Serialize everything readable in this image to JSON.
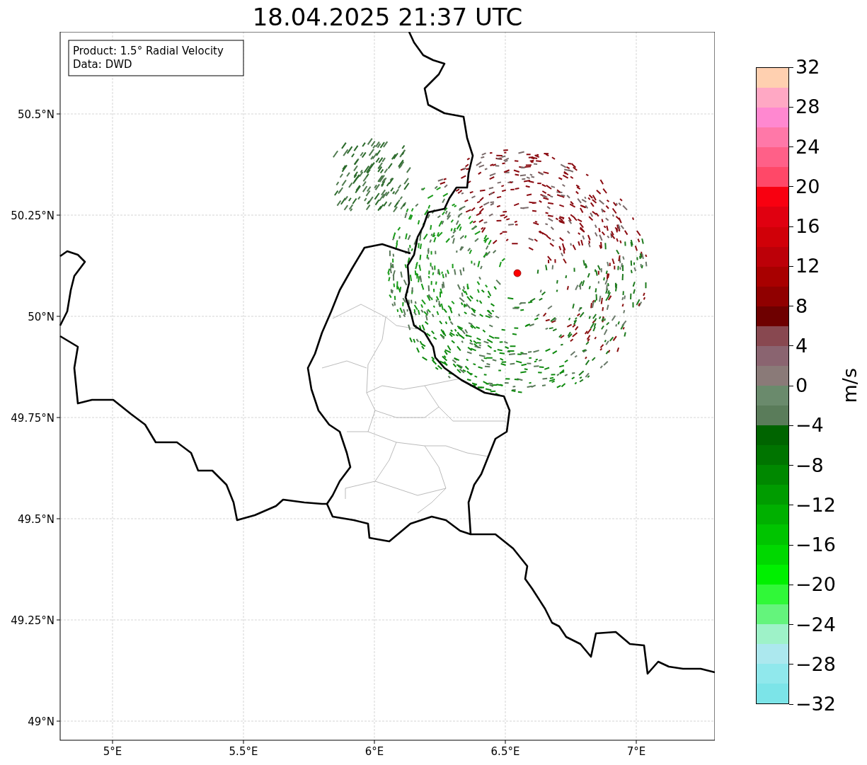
{
  "title": "18.04.2025 21:37 UTC",
  "info_box": {
    "lines": [
      "Product: 1.5° Radial Velocity",
      "Data: DWD"
    ]
  },
  "map": {
    "x_ticks": [
      "5°E",
      "5.5°E",
      "6°E",
      "6.5°E",
      "7°E"
    ],
    "y_ticks": [
      "50.5°N",
      "50.25°N",
      "50°N",
      "49.75°N",
      "49.5°N",
      "49.25°N",
      "49°N"
    ]
  },
  "colorbar": {
    "label": "m/s",
    "ticks": [
      "32",
      "28",
      "24",
      "20",
      "16",
      "12",
      "8",
      "4",
      "0",
      "−4",
      "−8",
      "−12",
      "−16",
      "−20",
      "−24",
      "−28",
      "−32"
    ],
    "bins": [
      {
        "color": "#ffd0b0"
      },
      {
        "color": "#ffa8c4"
      },
      {
        "color": "#ff88d0"
      },
      {
        "color": "#ff78a8"
      },
      {
        "color": "#ff6088"
      },
      {
        "color": "#ff4868"
      },
      {
        "color": "#f80010"
      },
      {
        "color": "#e00010"
      },
      {
        "color": "#d00008"
      },
      {
        "color": "#bc0008"
      },
      {
        "color": "#a80000"
      },
      {
        "color": "#900000"
      },
      {
        "color": "#6e0000"
      },
      {
        "color": "#884850"
      },
      {
        "color": "#8a6470"
      },
      {
        "color": "#8a7a78"
      },
      {
        "color": "#6a8a6c"
      },
      {
        "color": "#5a7c5a"
      },
      {
        "color": "#006400"
      },
      {
        "color": "#007400"
      },
      {
        "color": "#008800"
      },
      {
        "color": "#009c00"
      },
      {
        "color": "#00b000"
      },
      {
        "color": "#00c400"
      },
      {
        "color": "#00d800"
      },
      {
        "color": "#00f000"
      },
      {
        "color": "#30f838"
      },
      {
        "color": "#64f47c"
      },
      {
        "color": "#9ef2c8"
      },
      {
        "color": "#ace8ee"
      },
      {
        "color": "#90e8ec"
      },
      {
        "color": "#7ce4e8"
      }
    ]
  }
}
